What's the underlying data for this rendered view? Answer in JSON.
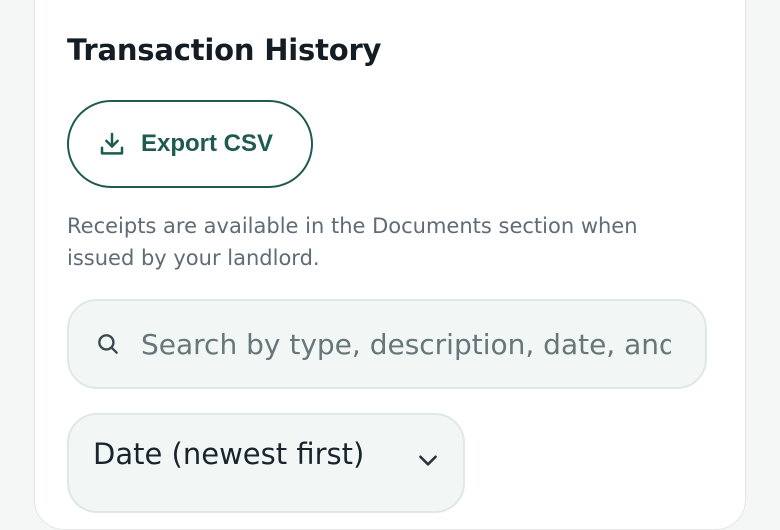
{
  "section": {
    "title": "Transaction History",
    "export_label": "Export CSV",
    "hint": "Receipts are available in the Documents section when issued by your landlord."
  },
  "search": {
    "placeholder": "Search by type, description, date, and amount",
    "value": "",
    "icon": "search-icon"
  },
  "sort": {
    "selected": "Date (newest first)",
    "icon": "chevron-down-icon"
  },
  "icons": {
    "export": "download-icon"
  },
  "colors": {
    "accent": "#1f5a50",
    "title": "#141c24",
    "muted_text": "#5f6b75",
    "field_bg": "#f2f6f5",
    "field_border": "#dfe8e5"
  }
}
